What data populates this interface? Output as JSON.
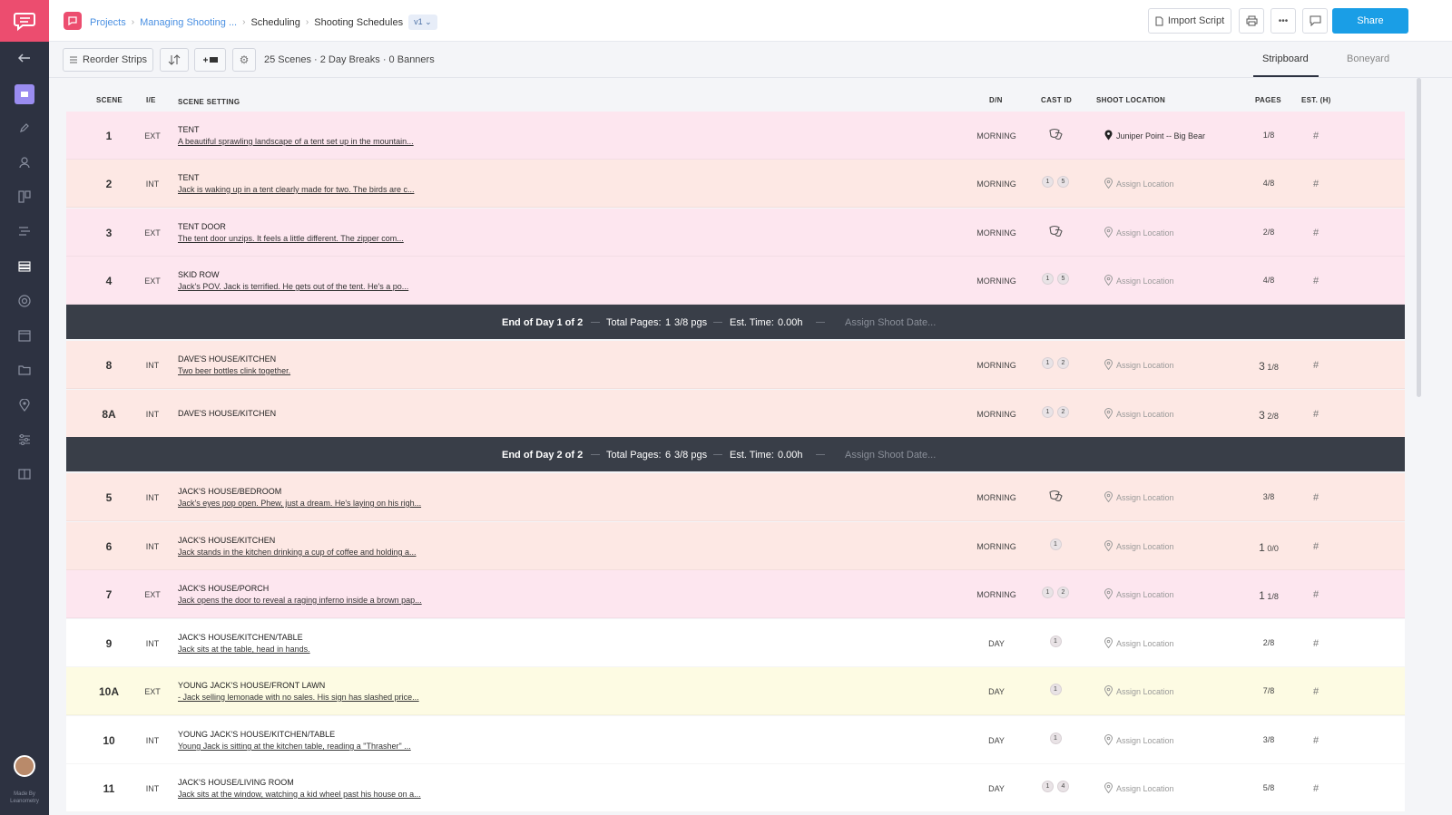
{
  "breadcrumbs": {
    "projects": "Projects",
    "project": "Managing Shooting ...",
    "section": "Scheduling",
    "page": "Shooting Schedules",
    "version": "v1"
  },
  "header": {
    "import_label": "Import Script",
    "share_label": "Share"
  },
  "toolbar": {
    "reorder_label": "Reorder Strips",
    "summary": "25 Scenes · 2 Day Breaks · 0 Banners",
    "tabs": [
      "Stripboard",
      "Boneyard"
    ]
  },
  "columns": {
    "scene": "SCENE",
    "ie": "I/E",
    "setting": "SCENE SETTING",
    "dn": "D/N",
    "cast": "CAST ID",
    "location": "SHOOT LOCATION",
    "pages": "PAGES",
    "est": "EST. (H)"
  },
  "rows": [
    {
      "scene": "1",
      "ie": "EXT",
      "title": "TENT",
      "desc": "A beautiful sprawling landscape of a tent set up in the mountain...",
      "dn": "MORNING",
      "cast": [],
      "location": "Juniper Point -- Big Bear",
      "pages": "1/8",
      "pages_whole": "",
      "est": "#",
      "color": "pink"
    },
    {
      "scene": "2",
      "ie": "INT",
      "title": "TENT",
      "desc": "Jack is waking up in a tent clearly made for two. The birds are c...",
      "dn": "MORNING",
      "cast": [
        "1",
        "5"
      ],
      "location": "Assign Location",
      "pages": "4/8",
      "pages_whole": "",
      "est": "#",
      "color": "salmon"
    },
    {
      "scene": "3",
      "ie": "EXT",
      "title": "TENT DOOR",
      "desc": "The tent door unzips. It feels a little different. The zipper com...",
      "dn": "MORNING",
      "cast": [],
      "location": "Assign Location",
      "pages": "2/8",
      "pages_whole": "",
      "est": "#",
      "color": "pink"
    },
    {
      "scene": "4",
      "ie": "EXT",
      "title": "SKID ROW",
      "desc": "Jack's POV. Jack is terrified. He gets out of the tent. He's a po...",
      "dn": "MORNING",
      "cast": [
        "1",
        "5"
      ],
      "location": "Assign Location",
      "pages": "4/8",
      "pages_whole": "",
      "est": "#",
      "color": "pink"
    },
    {
      "scene": "8",
      "ie": "INT",
      "title": "DAVE'S HOUSE/KITCHEN",
      "desc": "Two beer bottles clink together.",
      "dn": "MORNING",
      "cast": [
        "1",
        "2"
      ],
      "location": "Assign Location",
      "pages": "1/8",
      "pages_whole": "3",
      "est": "#",
      "color": "salmon"
    },
    {
      "scene": "8A",
      "ie": "INT",
      "title": "DAVE'S HOUSE/KITCHEN",
      "desc": "",
      "dn": "MORNING",
      "cast": [
        "1",
        "2"
      ],
      "location": "Assign Location",
      "pages": "2/8",
      "pages_whole": "3",
      "est": "#",
      "color": "salmon"
    },
    {
      "scene": "5",
      "ie": "INT",
      "title": "JACK'S HOUSE/BEDROOM",
      "desc": "Jack's eyes pop open. Phew, just a dream. He's laying on his righ...",
      "dn": "MORNING",
      "cast": [],
      "location": "Assign Location",
      "pages": "3/8",
      "pages_whole": "",
      "est": "#",
      "color": "salmon"
    },
    {
      "scene": "6",
      "ie": "INT",
      "title": "JACK'S HOUSE/KITCHEN",
      "desc": "Jack stands in the kitchen drinking a cup of coffee and holding a...",
      "dn": "MORNING",
      "cast": [
        "1"
      ],
      "location": "Assign Location",
      "pages": "0/0",
      "pages_whole": "1",
      "est": "#",
      "color": "salmon"
    },
    {
      "scene": "7",
      "ie": "EXT",
      "title": "JACK'S HOUSE/PORCH",
      "desc": "Jack opens the door to reveal a raging inferno inside a brown pap...",
      "dn": "MORNING",
      "cast": [
        "1",
        "2"
      ],
      "location": "Assign Location",
      "pages": "1/8",
      "pages_whole": "1",
      "est": "#",
      "color": "pink"
    },
    {
      "scene": "9",
      "ie": "INT",
      "title": "JACK'S HOUSE/KITCHEN/TABLE",
      "desc": "Jack sits at the table, head in hands.",
      "dn": "DAY",
      "cast": [
        "1"
      ],
      "location": "Assign Location",
      "pages": "2/8",
      "pages_whole": "",
      "est": "#",
      "color": "white"
    },
    {
      "scene": "10A",
      "ie": "EXT",
      "title": "YOUNG JACK'S HOUSE/FRONT LAWN",
      "desc": "- Jack selling lemonade with no sales. His sign has slashed price...",
      "dn": "DAY",
      "cast": [
        "1"
      ],
      "location": "Assign Location",
      "pages": "7/8",
      "pages_whole": "",
      "est": "#",
      "color": "yellow"
    },
    {
      "scene": "10",
      "ie": "INT",
      "title": "YOUNG JACK'S HOUSE/KITCHEN/TABLE",
      "desc": "Young Jack is sitting at the kitchen table, reading a \"Thrasher\" ...",
      "dn": "DAY",
      "cast": [
        "1"
      ],
      "location": "Assign Location",
      "pages": "3/8",
      "pages_whole": "",
      "est": "#",
      "color": "white"
    },
    {
      "scene": "11",
      "ie": "INT",
      "title": "JACK'S HOUSE/LIVING ROOM",
      "desc": "Jack sits at the window, watching a kid wheel past his house on a...",
      "dn": "DAY",
      "cast": [
        "1",
        "4"
      ],
      "location": "Assign Location",
      "pages": "5/8",
      "pages_whole": "",
      "est": "#",
      "color": "white"
    }
  ],
  "day_breaks": [
    {
      "label": "End of Day 1 of 2",
      "pages_label": "Total Pages:",
      "pages_whole": "1",
      "pages_frac": "3/8 pgs",
      "time_label": "Est. Time:",
      "time": "0.00h",
      "date": "Assign Shoot Date..."
    },
    {
      "label": "End of Day 2 of 2",
      "pages_label": "Total Pages:",
      "pages_whole": "6",
      "pages_frac": "3/8 pgs",
      "time_label": "Est. Time:",
      "time": "0.00h",
      "date": "Assign Shoot Date..."
    }
  ],
  "sidebar": {
    "made_by": "Made By Leanometry"
  },
  "colors": {
    "brand": "#ec4d6f",
    "share": "#1a9ee6",
    "sidebar": "#2d3241",
    "strip_pink": "#fde6ef",
    "strip_salmon": "#fde8e4",
    "strip_yellow": "#fdfbe3",
    "daybreak": "#393e48"
  }
}
